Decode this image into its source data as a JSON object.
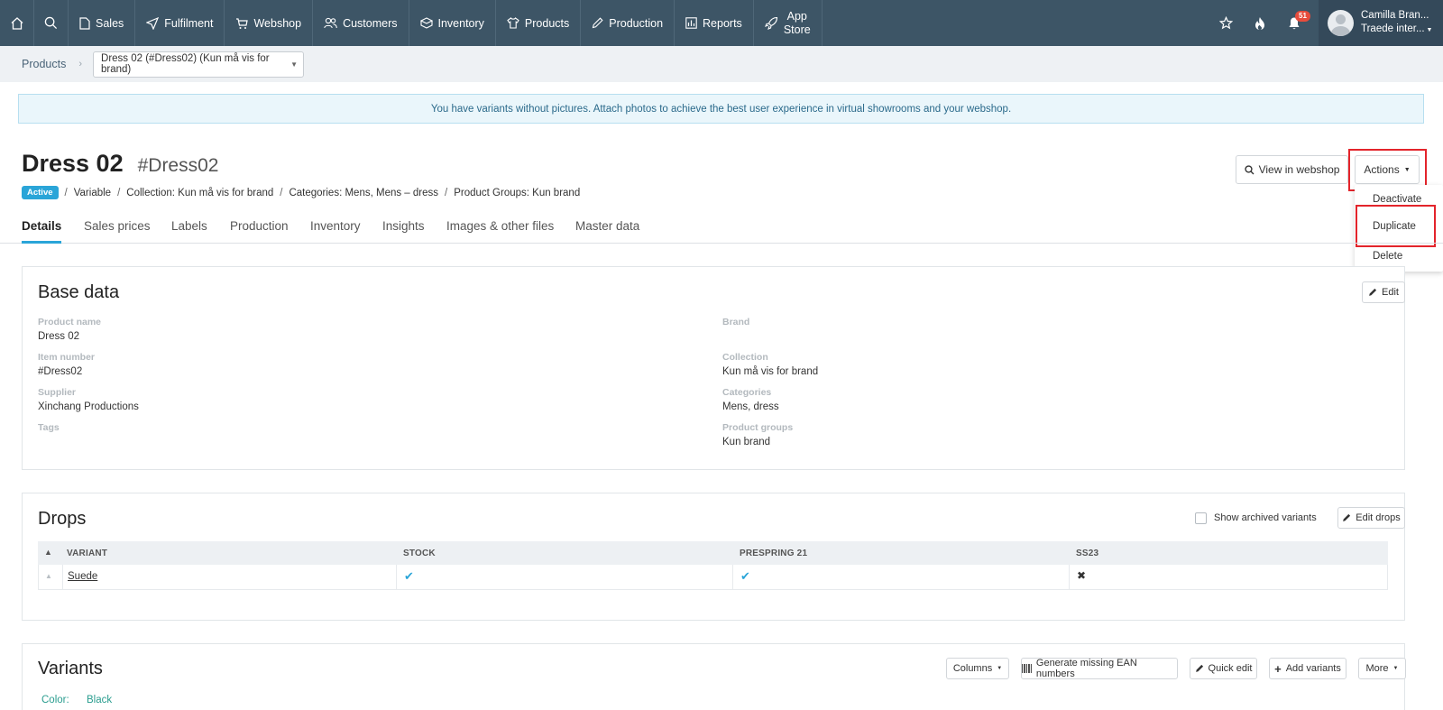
{
  "nav": {
    "items": [
      {
        "label": "Sales",
        "icon": "file-icon"
      },
      {
        "label": "Fulfilment",
        "icon": "send-icon"
      },
      {
        "label": "Webshop",
        "icon": "cart-icon"
      },
      {
        "label": "Customers",
        "icon": "users-icon"
      },
      {
        "label": "Inventory",
        "icon": "box-icon"
      },
      {
        "label": "Products",
        "icon": "shirt-icon"
      },
      {
        "label": "Production",
        "icon": "pencil-icon"
      },
      {
        "label": "Reports",
        "icon": "chart-icon"
      }
    ],
    "app_store_line1": "App",
    "app_store_line2": "Store",
    "notifications_count": "51",
    "user_name": "Camilla Bran...",
    "user_company": "Traede inter..."
  },
  "breadcrumb": {
    "root": "Products",
    "current": "Dress 02 (#Dress02) (Kun må vis for brand)"
  },
  "alert": "You have variants without pictures. Attach photos to achieve the best user experience in virtual showrooms and your webshop.",
  "product": {
    "name": "Dress 02",
    "number": "#Dress02",
    "status": "Active",
    "type": "Variable",
    "collection": "Collection: Kun må vis for brand",
    "categories": "Categories: Mens, Mens – dress",
    "groups": "Product Groups: Kun brand"
  },
  "header_actions": {
    "view_webshop": "View in webshop",
    "actions": "Actions",
    "menu": [
      "Deactivate",
      "Duplicate",
      "Delete"
    ]
  },
  "tabs": [
    "Details",
    "Sales prices",
    "Labels",
    "Production",
    "Inventory",
    "Insights",
    "Images & other files",
    "Master data"
  ],
  "base_data": {
    "title": "Base data",
    "edit": "Edit",
    "left": [
      {
        "label": "Product name",
        "value": "Dress 02"
      },
      {
        "label": "Item number",
        "value": "#Dress02"
      },
      {
        "label": "Supplier",
        "value": "Xinchang Productions"
      },
      {
        "label": "Tags",
        "value": ""
      }
    ],
    "right": [
      {
        "label": "Brand",
        "value": ""
      },
      {
        "label": "Collection",
        "value": "Kun må vis for brand"
      },
      {
        "label": "Categories",
        "value": "Mens, dress"
      },
      {
        "label": "Product groups",
        "value": "Kun brand"
      }
    ]
  },
  "drops": {
    "title": "Drops",
    "show_archived": "Show archived variants",
    "edit_drops": "Edit drops",
    "columns": [
      "VARIANT",
      "STOCK",
      "PRESPRING 21",
      "SS23"
    ],
    "rows": [
      {
        "variant": "Suede",
        "stock": "yes",
        "prespring21": "yes",
        "ss23": "no"
      }
    ]
  },
  "variants": {
    "title": "Variants",
    "columns_btn": "Columns",
    "generate_ean": "Generate missing EAN numbers",
    "quick_edit": "Quick edit",
    "add_variants": "Add variants",
    "more": "More",
    "color_label": "Color:",
    "color_value": "Black"
  },
  "colors": {
    "nav_bg": "#3d5566",
    "accent": "#2aa5d8",
    "highlight": "#e3242b"
  }
}
